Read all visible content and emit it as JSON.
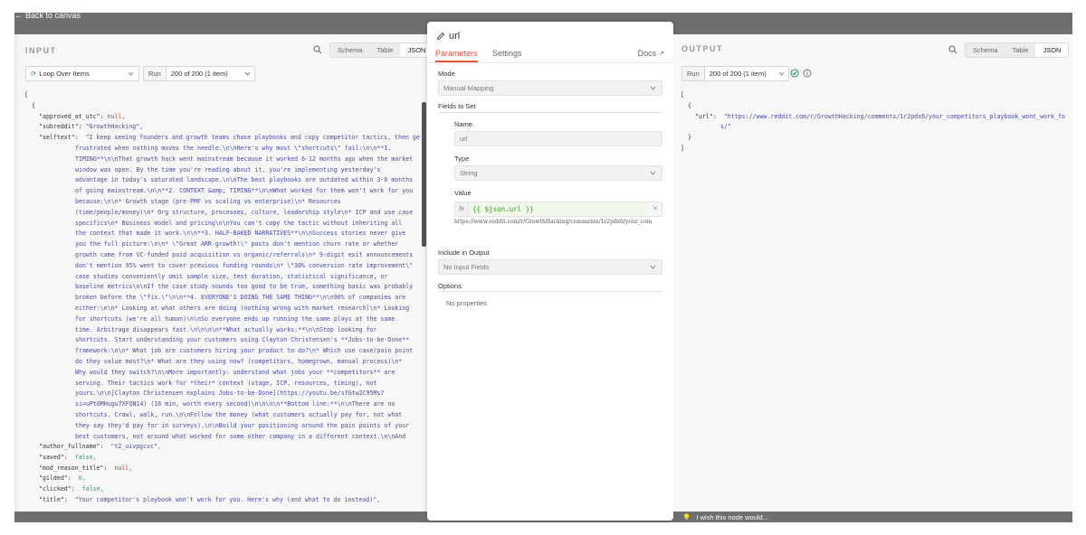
{
  "nav": {
    "back_label": "Back to canvas"
  },
  "input": {
    "title": "INPUT",
    "view_tabs": [
      "Schema",
      "Table",
      "JSON"
    ],
    "active_view": "JSON",
    "source_node": "Loop Over Items",
    "run_label": "Run",
    "run_value": "200 of 200 (1 item)",
    "json_lines": {
      "open_bracket": "[",
      "open_brace": "{",
      "approved_key": "\"approved_at_utc\":",
      "approved_val": "null,",
      "subreddit_key": "\"subreddit\":",
      "subreddit_val": "\"GrowthHacking\",",
      "selftext_key": "\"selftext\":",
      "selftext_first": "\"I keep seeing founders and growth teams chase playbooks and copy competitor tactics, then get",
      "selftext_rest": "frustrated when nothing moves the needle.\\n\\nHere's why most \\\"shortcuts\\\" fail:\\n\\n**1. TIMING**\\n\\nThat growth hack went mainstream because it worked 6-12 months ago when the market window was open. By the time you're reading about it, you're implementing yesterday's advantage in today's saturated landscape.\\n\\nThe best playbooks are outdated within 3-6 months of going mainstream.\\n\\n**2. CONTEXT &amp; TIMING**\\n\\nWhat worked for them won't work for you because:\\n\\n* Growth stage (pre-PMF vs scaling vs enterprise)\\n* Resources (time/people/money)\\n* Org structure, processes, culture, leadership style\\n* ICP and use case specifics\\n* Business model and pricing\\n\\nYou can't copy the tactic without inheriting all the context that made it work.\\n\\n**3. HALF-BAKED NARRATIVES**\\n\\nSuccess stories never give you the full picture:\\n\\n* \\\"Great ARR growth!\\\" posts don't mention churn rate or whether growth came from VC-funded paid acquisition vs organic/referrals\\n* 9-digit exit announcements don't mention 95% went to cover previous funding rounds\\n* \\\"30% conversion rate improvement\\\" case studies conveniently omit sample size, test duration, statistical significance, or baseline metrics\\n\\nIf the case study sounds too good to be true, something basic was probably broken before the \\\"fix.\\\"\\n\\n**4. EVERYONE'S DOING THE SAME THING**\\n\\n90% of companies are either:\\n\\n* Looking at what others are doing (nothing wrong with market research)\\n* Looking for shortcuts (we're all human)\\n\\nSo everyone ends up running the same plays at the same time. Arbitrage disappears fast.\\n\\n\\n\\n**What actually works:**\\n\\nStop looking for shortcuts. Start understanding your customers using Clayton Christensen's **Jobs-to-be-Done** framework:\\n\\n* What job are customers hiring your product to do?\\n* Which use case/pain point do they value most?\\n* What are they using now? (competitors, homegrown, manual process)\\n* Why would they switch?\\n\\nMore importantly: understand what jobs your **competitors** are serving. Their tactics work for *their* context (stage, ICP, resources, timing), not yours.\\n\\n[Clayton Christensen explains Jobs-to-be-Done](https://youtu.be/sfGtw2C95Ms?si=uPt6MHugu7XFQN14) (16 min, worth every second)\\n\\n\\n\\n**Bottom line:**\\n\\nThere are no shortcuts. Crawl, walk, run.\\n\\nFollow the money (what customers actually pay for, not what they say they'd pay for in surveys).\\n\\nBuild your positioning around the pain points of your best customers, not around what worked for some other company in a different context.\\n\\nAnd remember: **marketing is an amplifier, not a fixer**. \\n\\nIf your positioning, pricing, or product-market fit is off, no amount of \\\"growth hacking\\\" will save you.\",",
      "author_key": "\"author_fullname\":",
      "author_val": "\"t2_uivpgcvc\",",
      "saved_key": "\"saved\":",
      "saved_val": "false,",
      "mod_key": "\"mod_reason_title\":",
      "mod_val": "null,",
      "gilded_key": "\"gilded\":",
      "gilded_val": "0,",
      "clicked_key": "\"clicked\":",
      "clicked_val": "false,",
      "title_key": "\"title\":",
      "title_val": "\"Your competitor's playbook won't work for you. Here's why (and what to do instead)\","
    }
  },
  "params": {
    "node_name": "url",
    "tabs": [
      "Parameters",
      "Settings"
    ],
    "active_tab": "Parameters",
    "docs_label": "Docs",
    "mode_label": "Mode",
    "mode_value": "Manual Mapping",
    "fields_label": "Fields to Set",
    "name_label": "Name",
    "name_value": "url",
    "type_label": "Type",
    "type_value": "String",
    "value_label": "Value",
    "value_fx": "fx",
    "value_expr": "{{ $json.url }}",
    "value_preview": "https://www.reddit.com/r/GrowthHacking/comments/1r2pdx6/your_com",
    "include_label": "Include in Output",
    "include_value": "No Input Fields",
    "options_label": "Options",
    "options_empty": "No properties"
  },
  "output": {
    "title": "OUTPUT",
    "view_tabs": [
      "Schema",
      "Table",
      "JSON"
    ],
    "active_view": "JSON",
    "run_label": "Run",
    "run_value": "200 of 200 (1 item)",
    "json_lines": {
      "open_bracket": "[",
      "open_brace": "{",
      "url_key": "\"url\":",
      "url_val": "\"https://www.reddit.com/r/GrowthHacking/comments/1r2pdx6/your_competitors_playbook_wont_work_for_you_h",
      "url_cont": "s/\"",
      "close_brace": "}",
      "close_bracket": "]"
    }
  },
  "footer": {
    "feedback_label": "I wish this node would..."
  },
  "colors": {
    "accent": "#e5533b",
    "expression_green": "#3c9a2f",
    "success": "#2e9c6f",
    "backdrop": "#6f6f6f"
  }
}
